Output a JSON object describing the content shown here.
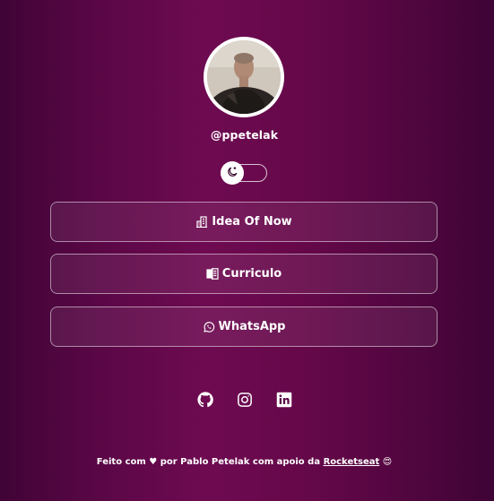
{
  "profile": {
    "username": "@ppetelak",
    "avatar_alt": "avatar"
  },
  "theme_toggle": {
    "icon": "moon-icon"
  },
  "links": [
    {
      "label": "Idea Of Now",
      "icon": "building-icon"
    },
    {
      "label": "Curriculo",
      "icon": "documents-icon"
    },
    {
      "label": "WhatsApp",
      "icon": "whatsapp-icon"
    }
  ],
  "socials": [
    {
      "icon": "github-icon"
    },
    {
      "icon": "instagram-icon"
    },
    {
      "icon": "linkedin-icon"
    }
  ],
  "footer": {
    "prefix": "Feito com",
    "heart": "♥",
    "middle": "por Pablo Petelak com apoio da",
    "link": "Rocketseat",
    "emoji": "😍"
  },
  "colors": {
    "background_center": "#6e0a51",
    "background_edge": "#400436",
    "text": "#ffffff"
  }
}
